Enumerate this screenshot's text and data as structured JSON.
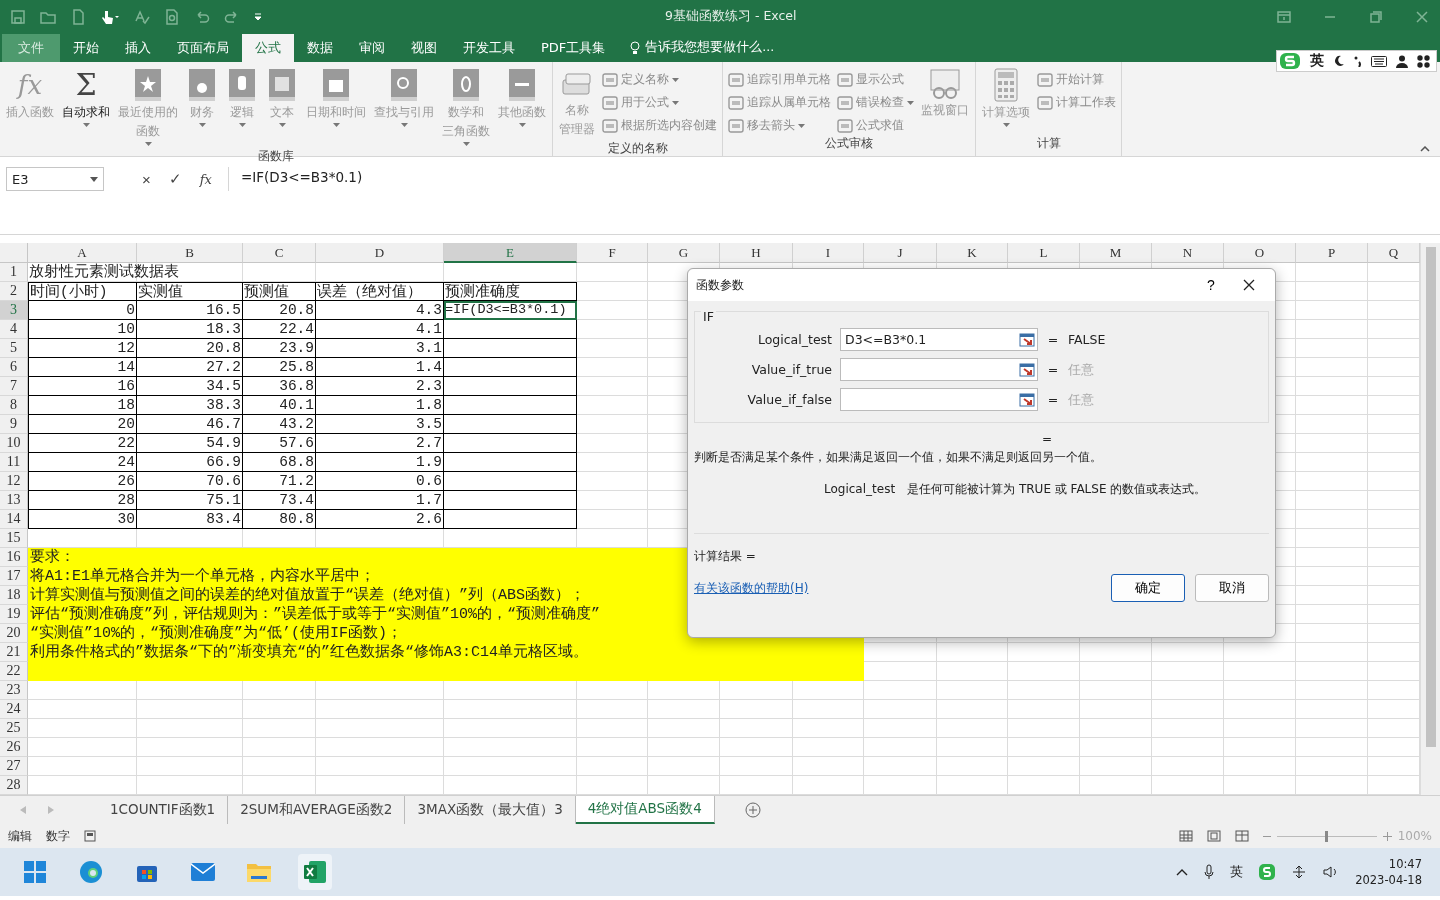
{
  "window": {
    "title": "9基础函数练习 - Excel"
  },
  "menu_tabs": [
    {
      "label": "文件",
      "selected": false
    },
    {
      "label": "开始",
      "selected": false
    },
    {
      "label": "插入",
      "selected": false
    },
    {
      "label": "页面布局",
      "selected": false
    },
    {
      "label": "公式",
      "selected": true
    },
    {
      "label": "数据",
      "selected": false
    },
    {
      "label": "审阅",
      "selected": false
    },
    {
      "label": "视图",
      "selected": false
    },
    {
      "label": "开发工具",
      "selected": false
    },
    {
      "label": "PDF工具集",
      "selected": false
    }
  ],
  "tell_me": "告诉我您想要做什么...",
  "ime_toolbar": {
    "mode": "英"
  },
  "ribbon": [
    {
      "label": "函数库",
      "items": [
        {
          "kind": "glyph",
          "glyph": "fx",
          "lines": [
            "插入函数"
          ],
          "dropdown": false,
          "disabled": true
        },
        {
          "kind": "glyph",
          "glyph": "Σ",
          "lines": [
            "自动求和"
          ],
          "dropdown": true,
          "disabled": false
        },
        {
          "kind": "book",
          "lines": [
            "最近使用的",
            "函数"
          ],
          "dropdown": true,
          "disabled": true
        },
        {
          "kind": "book",
          "lines": [
            "财务"
          ],
          "dropdown": true,
          "disabled": true
        },
        {
          "kind": "book",
          "lines": [
            "逻辑"
          ],
          "dropdown": true,
          "disabled": true
        },
        {
          "kind": "book",
          "lines": [
            "文本"
          ],
          "dropdown": true,
          "disabled": true
        },
        {
          "kind": "book",
          "lines": [
            "日期和时间"
          ],
          "dropdown": true,
          "disabled": true
        },
        {
          "kind": "book",
          "lines": [
            "查找与引用"
          ],
          "dropdown": true,
          "disabled": true
        },
        {
          "kind": "book",
          "lines": [
            "数学和",
            "三角函数"
          ],
          "dropdown": true,
          "disabled": true
        },
        {
          "kind": "book",
          "lines": [
            "其他函数"
          ],
          "dropdown": true,
          "disabled": true
        }
      ]
    },
    {
      "label": "定义的名称",
      "items": [
        {
          "kind": "tool",
          "lines": [
            "名称",
            "管理器"
          ],
          "dropdown": false,
          "disabled": true
        },
        {
          "kind": "stack",
          "items": [
            {
              "label": "定义名称",
              "dropdown": true,
              "disabled": true
            },
            {
              "label": "用于公式",
              "dropdown": true,
              "disabled": true
            },
            {
              "label": "根据所选内容创建",
              "dropdown": false,
              "disabled": true
            }
          ]
        }
      ]
    },
    {
      "label": "公式审核",
      "items": [
        {
          "kind": "stack",
          "items": [
            {
              "label": "追踪引用单元格",
              "dropdown": false,
              "disabled": true
            },
            {
              "label": "追踪从属单元格",
              "dropdown": false,
              "disabled": true
            },
            {
              "label": "移去箭头",
              "dropdown": true,
              "disabled": true
            }
          ]
        },
        {
          "kind": "stack",
          "items": [
            {
              "label": "显示公式",
              "dropdown": false,
              "disabled": true
            },
            {
              "label": "错误检查",
              "dropdown": true,
              "disabled": true
            },
            {
              "label": "公式求值",
              "dropdown": false,
              "disabled": true
            }
          ]
        },
        {
          "kind": "tool",
          "lines": [
            "监视窗口"
          ],
          "dropdown": false,
          "disabled": true
        }
      ]
    },
    {
      "label": "计算",
      "items": [
        {
          "kind": "tool",
          "lines": [
            "计算选项"
          ],
          "dropdown": true,
          "disabled": true
        },
        {
          "kind": "stack",
          "items": [
            {
              "label": "开始计算",
              "dropdown": false,
              "disabled": true
            },
            {
              "label": "计算工作表",
              "dropdown": false,
              "disabled": true
            }
          ]
        }
      ]
    }
  ],
  "formula_bar": {
    "name_box": "E3",
    "cancel": "×",
    "enter": "✓",
    "fx": "fx",
    "formula": "=IF(D3<=B3*0.1)"
  },
  "sheet": {
    "columns": [
      {
        "label": "A",
        "selected": false
      },
      {
        "label": "B",
        "selected": false
      },
      {
        "label": "C",
        "selected": false
      },
      {
        "label": "D",
        "selected": false
      },
      {
        "label": "E",
        "selected": true
      },
      {
        "label": "F",
        "selected": false
      },
      {
        "label": "G",
        "selected": false
      },
      {
        "label": "H",
        "selected": false
      },
      {
        "label": "I",
        "selected": false
      },
      {
        "label": "J",
        "selected": false
      },
      {
        "label": "K",
        "selected": false
      },
      {
        "label": "L",
        "selected": false
      },
      {
        "label": "M",
        "selected": false
      },
      {
        "label": "N",
        "selected": false
      },
      {
        "label": "O",
        "selected": false
      },
      {
        "label": "P",
        "selected": false
      },
      {
        "label": "Q",
        "selected": false
      }
    ],
    "row_numbers": [
      {
        "label": "1",
        "selected": false
      },
      {
        "label": "2",
        "selected": false
      },
      {
        "label": "3",
        "selected": true
      },
      {
        "label": "4",
        "selected": false
      },
      {
        "label": "5",
        "selected": false
      },
      {
        "label": "6",
        "selected": false
      },
      {
        "label": "7",
        "selected": false
      },
      {
        "label": "8",
        "selected": false
      },
      {
        "label": "9",
        "selected": false
      },
      {
        "label": "10",
        "selected": false
      },
      {
        "label": "11",
        "selected": false
      },
      {
        "label": "12",
        "selected": false
      },
      {
        "label": "13",
        "selected": false
      },
      {
        "label": "14",
        "selected": false
      },
      {
        "label": "15",
        "selected": false
      },
      {
        "label": "16",
        "selected": false
      },
      {
        "label": "17",
        "selected": false
      },
      {
        "label": "18",
        "selected": false
      },
      {
        "label": "19",
        "selected": false
      },
      {
        "label": "20",
        "selected": false
      },
      {
        "label": "21",
        "selected": false
      },
      {
        "label": "22",
        "selected": false
      },
      {
        "label": "23",
        "selected": false
      },
      {
        "label": "24",
        "selected": false
      },
      {
        "label": "25",
        "selected": false
      },
      {
        "label": "26",
        "selected": false
      },
      {
        "label": "27",
        "selected": false
      },
      {
        "label": "28",
        "selected": false
      }
    ],
    "title": "放射性元素测试数据表",
    "table": {
      "columns": [
        "时间(小时)",
        "实测值",
        "预测值",
        "误差（绝对值）",
        "预测准确度"
      ],
      "rows": [
        {
          "cells": [
            "0",
            "16.5",
            "20.8",
            "4.3"
          ]
        },
        {
          "cells": [
            "10",
            "18.3",
            "22.4",
            "4.1"
          ]
        },
        {
          "cells": [
            "12",
            "20.8",
            "23.9",
            "3.1"
          ]
        },
        {
          "cells": [
            "14",
            "27.2",
            "25.8",
            "1.4"
          ]
        },
        {
          "cells": [
            "16",
            "34.5",
            "36.8",
            "2.3"
          ]
        },
        {
          "cells": [
            "18",
            "38.3",
            "40.1",
            "1.8"
          ]
        },
        {
          "cells": [
            "20",
            "46.7",
            "43.2",
            "3.5"
          ]
        },
        {
          "cells": [
            "22",
            "54.9",
            "57.6",
            "2.7"
          ]
        },
        {
          "cells": [
            "24",
            "66.9",
            "68.8",
            "1.9"
          ]
        },
        {
          "cells": [
            "26",
            "70.6",
            "71.2",
            "0.6"
          ]
        },
        {
          "cells": [
            "28",
            "75.1",
            "73.4",
            "1.7"
          ]
        },
        {
          "cells": [
            "30",
            "83.4",
            "80.8",
            "2.6"
          ]
        }
      ]
    },
    "editing_cell": "=IF(D3<=B3*0.1)",
    "notes": [
      "要求：",
      "将A1:E1单元格合并为一个单元格，内容水平居中；",
      "计算实测值与预测值之间的误差的绝对值放置于“误差（绝对值）”列（ABS函数）；",
      "评估“预测准确度”列，评估规则为：”误差低于或等于“实测值”10%的，“预测准确度”",
      "“实测值”10%的，“预测准确度”为“低’(使用IF函数)；",
      "利用条件格式的”数据条“下的”渐变填充“的”红色数据条“修饰A3:C14单元格区域。"
    ]
  },
  "dialog": {
    "title": "函数参数",
    "help": "?",
    "function": "IF",
    "args": [
      {
        "name": "Logical_test",
        "value": "D3<=B3*0.1",
        "result": "FALSE",
        "placeholder_result": false
      },
      {
        "name": "Value_if_true",
        "result": "任意",
        "placeholder_result": true
      },
      {
        "name": "Value_if_false",
        "result": "任意",
        "placeholder_result": true
      }
    ],
    "total": "=",
    "description": "判断是否满足某个条件，如果满足返回一个值，如果不满足则返回另一个值。",
    "arg_name": "Logical_test",
    "arg_description": "是任何可能被计算为 TRUE 或 FALSE 的数值或表达式。",
    "result_label": "计算结果 =",
    "help_link": "有关该函数的帮助(H)",
    "ok": "确定",
    "cancel": "取消"
  },
  "sheet_tabs": [
    {
      "label": "1COUNTIF函数1",
      "selected": false
    },
    {
      "label": "2SUM和AVERAGE函数2",
      "selected": false
    },
    {
      "label": "3MAX函数（最大值）3",
      "selected": false
    },
    {
      "label": "4绝对值ABS函数4",
      "selected": true
    }
  ],
  "status_bar": {
    "mode": "编辑",
    "num": "数字",
    "zoom": {
      "level": 0.5,
      "reading": "100%"
    }
  },
  "taskbar": {
    "tray_ime": "英",
    "time": "10:47",
    "date": "2023-04-18"
  }
}
